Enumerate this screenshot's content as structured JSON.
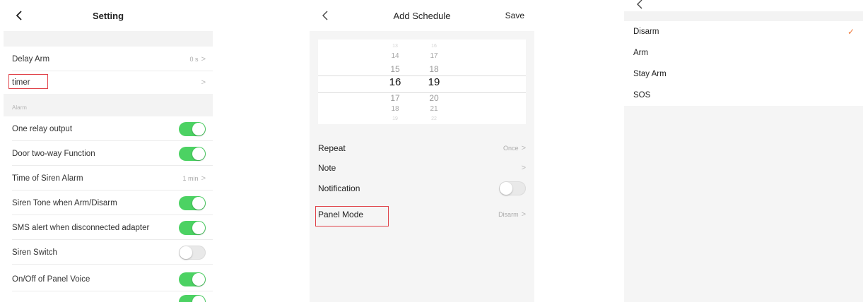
{
  "setting": {
    "title": "Setting",
    "rows": [
      {
        "label": "Delay Arm",
        "value": "0 s",
        "chevron": ">"
      },
      {
        "label": "timer",
        "chevron": ">"
      }
    ],
    "section_label": "Alarm",
    "switch_rows": [
      {
        "label": "One relay output",
        "on": true
      },
      {
        "label": "Door two-way Function",
        "on": true
      },
      {
        "label": "Time of Siren Alarm",
        "value": "1 min",
        "chevron": ">"
      },
      {
        "label": "Siren Tone when Arm/Disarm",
        "on": true
      },
      {
        "label": "SMS alert when disconnected adapter",
        "on": true
      },
      {
        "label": "Siren Switch",
        "on": false
      },
      {
        "label": "On/Off of Panel Voice",
        "on": true
      }
    ]
  },
  "schedule": {
    "title": "Add Schedule",
    "save_label": "Save",
    "hours": [
      "13",
      "14",
      "15",
      "16",
      "17",
      "18",
      "19"
    ],
    "minutes": [
      "16",
      "17",
      "18",
      "19",
      "20",
      "21",
      "22"
    ],
    "rows": [
      {
        "label": "Repeat",
        "value": "Once",
        "chevron": ">"
      },
      {
        "label": "Note",
        "chevron": ">"
      },
      {
        "label": "Notification",
        "toggle_on": false
      },
      {
        "label": "Panel Mode",
        "value": "Disarm",
        "chevron": ">"
      }
    ]
  },
  "mode": {
    "options": [
      {
        "label": "Disarm",
        "selected": true,
        "check": "✓"
      },
      {
        "label": "Arm",
        "selected": false
      },
      {
        "label": "Stay Arm",
        "selected": false
      },
      {
        "label": "SOS",
        "selected": false
      }
    ]
  },
  "colors": {
    "toggle_on": "#4cd263",
    "toggle_off": "#e9e9e9",
    "highlight": "#e0434a",
    "check": "#ef7a3c"
  }
}
